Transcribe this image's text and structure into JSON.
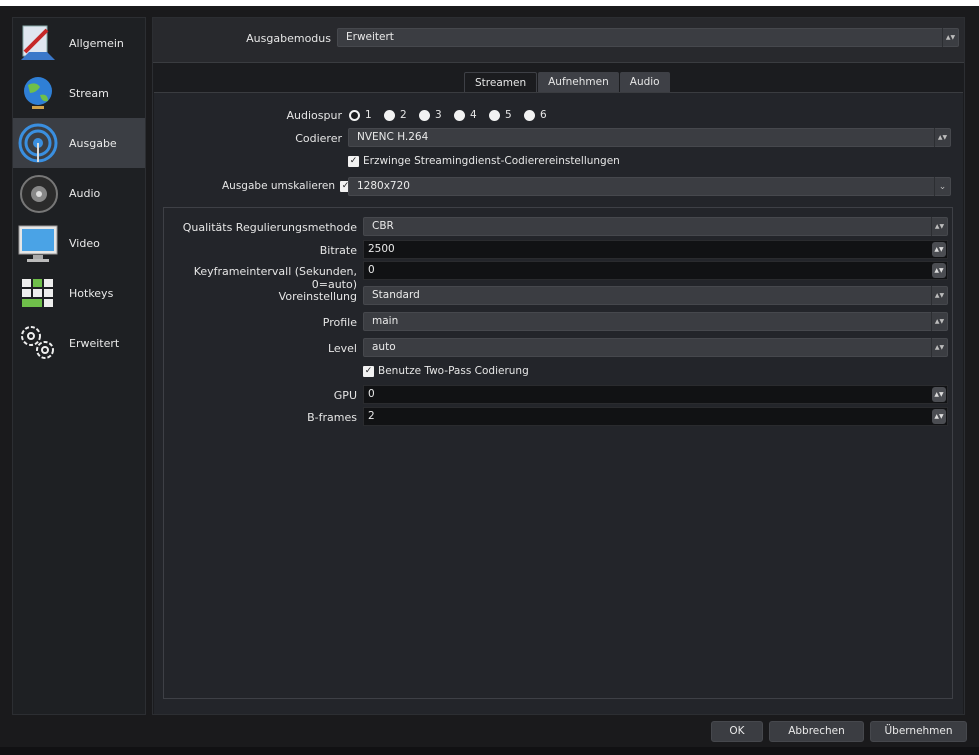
{
  "sidebar": {
    "items": [
      {
        "label": "Allgemein",
        "icon": "general-icon"
      },
      {
        "label": "Stream",
        "icon": "globe-icon"
      },
      {
        "label": "Ausgabe",
        "icon": "output-icon"
      },
      {
        "label": "Audio",
        "icon": "speaker-icon"
      },
      {
        "label": "Video",
        "icon": "monitor-icon"
      },
      {
        "label": "Hotkeys",
        "icon": "keyboard-icon"
      },
      {
        "label": "Erweitert",
        "icon": "gears-icon"
      }
    ],
    "active_index": 2
  },
  "output_mode": {
    "label": "Ausgabemodus",
    "value": "Erweitert"
  },
  "tabs": [
    "Streamen",
    "Aufnehmen",
    "Audio"
  ],
  "active_tab": "Streamen",
  "streaming": {
    "audio_track": {
      "label": "Audiospur",
      "options": [
        "1",
        "2",
        "3",
        "4",
        "5",
        "6"
      ],
      "selected": "1"
    },
    "encoder": {
      "label": "Codierer",
      "value": "NVENC H.264"
    },
    "enforce_settings": {
      "label": "Erzwinge Streamingdienst-Codierereinstellungen",
      "checked": true
    },
    "rescale": {
      "label": "Ausgabe umskalieren",
      "checked": true,
      "value": "1280x720"
    }
  },
  "encoder_settings": {
    "rate_control": {
      "label": "Qualitäts Regulierungsmethode",
      "value": "CBR"
    },
    "bitrate": {
      "label": "Bitrate",
      "value": "2500"
    },
    "keyframe": {
      "label": "Keyframeintervall (Sekunden, 0=auto)",
      "value": "0"
    },
    "preset": {
      "label": "Voreinstellung",
      "value": "Standard"
    },
    "profile": {
      "label": "Profile",
      "value": "main"
    },
    "level": {
      "label": "Level",
      "value": "auto"
    },
    "two_pass": {
      "label": "Benutze Two-Pass Codierung",
      "checked": true
    },
    "gpu": {
      "label": "GPU",
      "value": "0"
    },
    "bframes": {
      "label": "B-frames",
      "value": "2"
    }
  },
  "buttons": {
    "ok": "OK",
    "cancel": "Abbrechen",
    "apply": "Übernehmen"
  },
  "colors": {
    "accent": "#3b3e44",
    "background": "#1b1c1f"
  }
}
